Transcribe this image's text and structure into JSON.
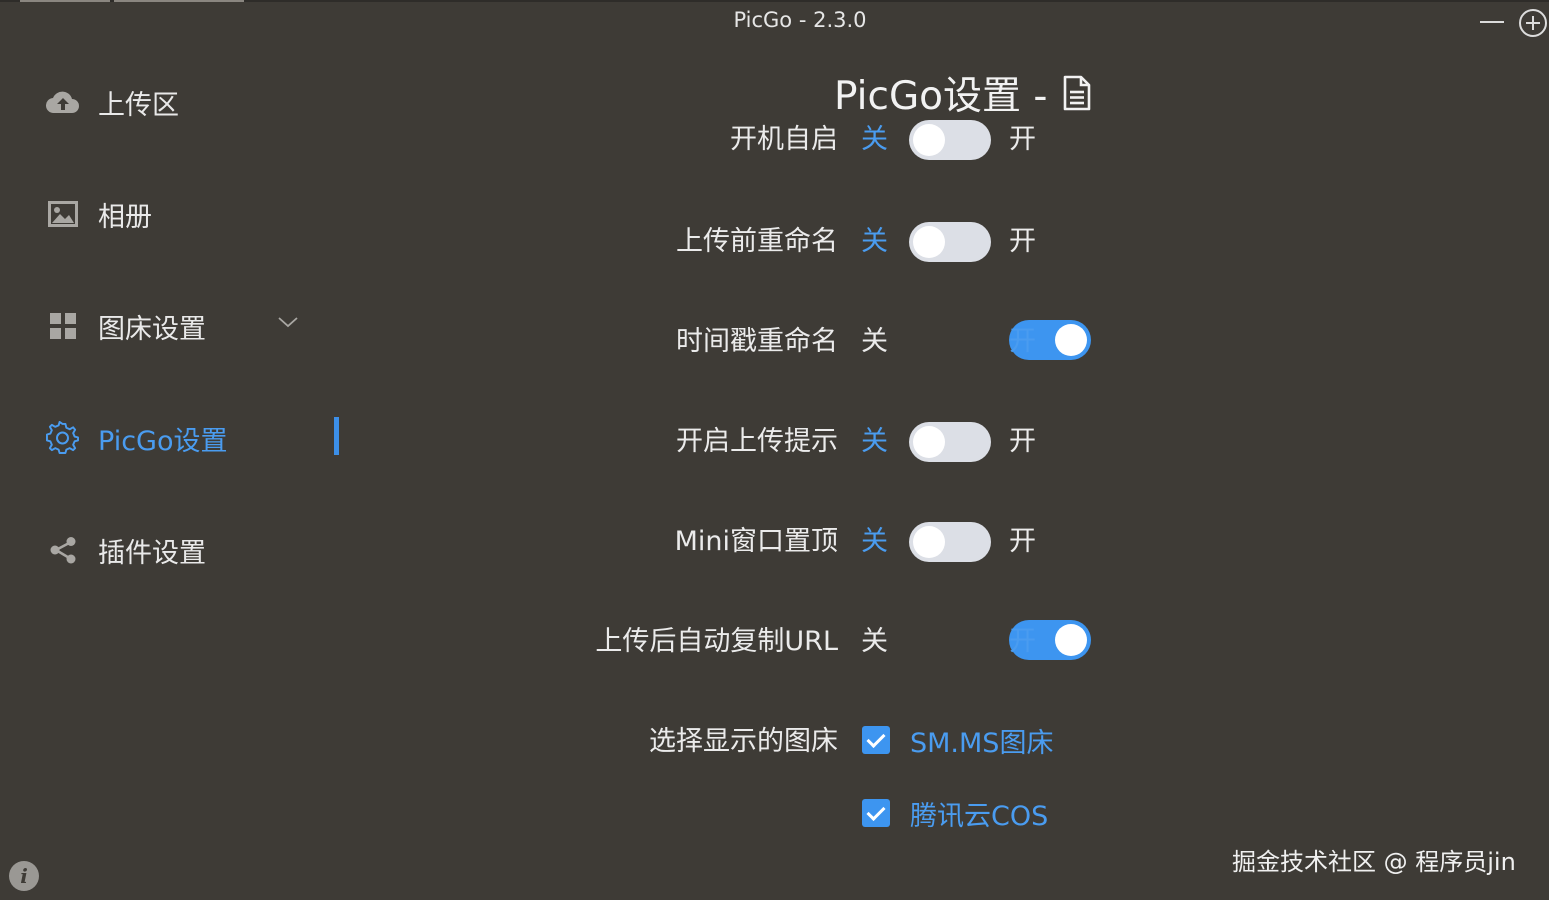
{
  "window": {
    "title": "PicGo - 2.3.0"
  },
  "sidebar": {
    "items": [
      {
        "label": "上传区",
        "icon": "cloud-upload-icon"
      },
      {
        "label": "相册",
        "icon": "image-icon"
      },
      {
        "label": "图床设置",
        "icon": "grid-icon"
      },
      {
        "label": "PicGo设置",
        "icon": "gear-icon",
        "active": true
      },
      {
        "label": "插件设置",
        "icon": "share-icon"
      }
    ]
  },
  "main": {
    "title": "PicGo设置 -",
    "off_label": "关",
    "on_label": "开",
    "settings": [
      {
        "label": "开机自启",
        "on": false
      },
      {
        "label": "上传前重命名",
        "on": false
      },
      {
        "label": "时间戳重命名",
        "on": true
      },
      {
        "label": "开启上传提示",
        "on": false
      },
      {
        "label": "Mini窗口置顶",
        "on": false
      },
      {
        "label": "上传后自动复制URL",
        "on": true
      }
    ],
    "picbed_label": "选择显示的图床",
    "picbeds": [
      {
        "label": "SM.MS图床",
        "checked": true
      },
      {
        "label": "腾讯云COS",
        "checked": true
      }
    ]
  },
  "watermark": "掘金技术社区 @ 程序员jin",
  "colors": {
    "background": "#3e3b36",
    "accent": "#4a9cf0",
    "switch_off": "#dcdfe6"
  }
}
